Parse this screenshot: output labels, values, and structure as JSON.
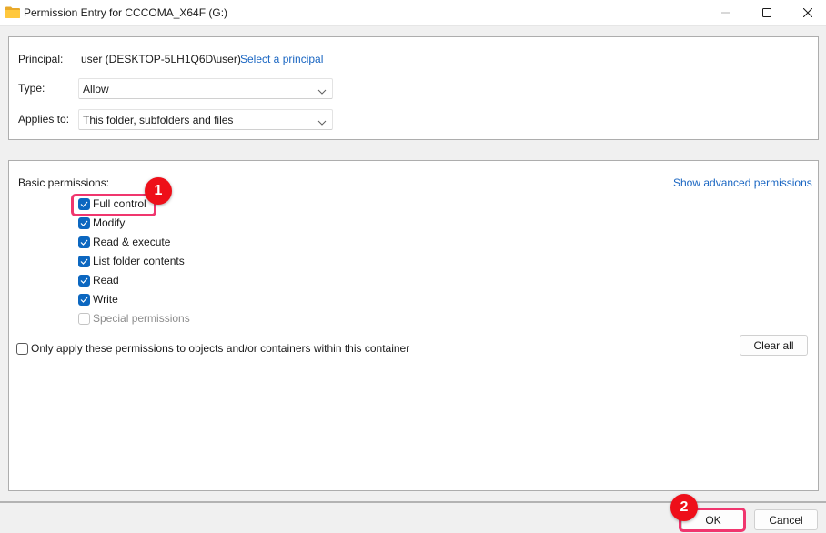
{
  "window": {
    "title": "Permission Entry for CCCOMA_X64F (G:)",
    "icon": "folder-icon",
    "controls": [
      "minimize-icon",
      "maximize-icon",
      "close-icon"
    ]
  },
  "principal": {
    "label": "Principal:",
    "value": "user (DESKTOP-5LH1Q6D\\user)",
    "link": "Select a principal"
  },
  "type": {
    "label": "Type:",
    "selected": "Allow"
  },
  "applies_to": {
    "label": "Applies to:",
    "selected": "This folder, subfolders and files"
  },
  "basic_permissions": {
    "heading": "Basic permissions:",
    "advanced_link": "Show advanced permissions",
    "items": [
      {
        "label": "Full control",
        "checked": true,
        "enabled": true
      },
      {
        "label": "Modify",
        "checked": true,
        "enabled": true
      },
      {
        "label": "Read & execute",
        "checked": true,
        "enabled": true
      },
      {
        "label": "List folder contents",
        "checked": true,
        "enabled": true
      },
      {
        "label": "Read",
        "checked": true,
        "enabled": true
      },
      {
        "label": "Write",
        "checked": true,
        "enabled": true
      },
      {
        "label": "Special permissions",
        "checked": false,
        "enabled": false
      }
    ]
  },
  "only_apply": {
    "label": "Only apply these permissions to objects and/or containers within this container",
    "checked": false
  },
  "buttons": {
    "clear_all": "Clear all",
    "ok": "OK",
    "cancel": "Cancel"
  },
  "annotations": {
    "step1": "1",
    "step2": "2",
    "highlight_color": "#f0366e",
    "badge_color": "#ee0f19"
  },
  "colors": {
    "accent": "#0c67c0",
    "link": "#1a66c2"
  }
}
